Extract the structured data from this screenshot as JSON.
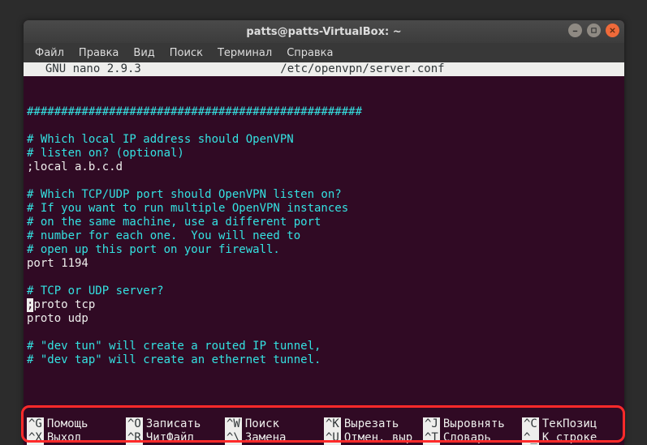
{
  "window": {
    "title": "patts@patts-VirtualBox: ~"
  },
  "menubar": {
    "items": [
      "Файл",
      "Правка",
      "Вид",
      "Поиск",
      "Терминал",
      "Справка"
    ]
  },
  "nano": {
    "app": "  GNU nano 2.9.3",
    "file": "/etc/openvpn/server.conf"
  },
  "lines": {
    "l0": "",
    "l1": "#################################################",
    "l2": "",
    "l3": "# Which local IP address should OpenVPN",
    "l4": "# listen on? (optional)",
    "l5": ";local a.b.c.d",
    "l6": "",
    "l7": "# Which TCP/UDP port should OpenVPN listen on?",
    "l8": "# If you want to run multiple OpenVPN instances",
    "l9": "# on the same machine, use a different port",
    "l10": "# number for each one.  You will need to",
    "l11": "# open up this port on your firewall.",
    "l12": "port 1194",
    "l13": "",
    "l14": "# TCP or UDP server?",
    "l15a": ";",
    "l15b": "proto tcp",
    "l16": "proto udp",
    "l17": "",
    "l18": "# \"dev tun\" will create a routed IP tunnel,",
    "l19": "# \"dev tap\" will create an ethernet tunnel."
  },
  "shortcuts": {
    "row1": [
      {
        "key": "^G",
        "label": "Помощь"
      },
      {
        "key": "^O",
        "label": "Записать"
      },
      {
        "key": "^W",
        "label": "Поиск"
      },
      {
        "key": "^K",
        "label": "Вырезать"
      },
      {
        "key": "^J",
        "label": "Выровнять"
      },
      {
        "key": "^C",
        "label": "ТекПозиц"
      }
    ],
    "row2": [
      {
        "key": "^X",
        "label": "Выход"
      },
      {
        "key": "^R",
        "label": "ЧитФайл"
      },
      {
        "key": "^\\",
        "label": "Замена"
      },
      {
        "key": "^U",
        "label": "Отмен. выр"
      },
      {
        "key": "^T",
        "label": "Словарь"
      },
      {
        "key": "^_",
        "label": "К строке"
      }
    ]
  }
}
